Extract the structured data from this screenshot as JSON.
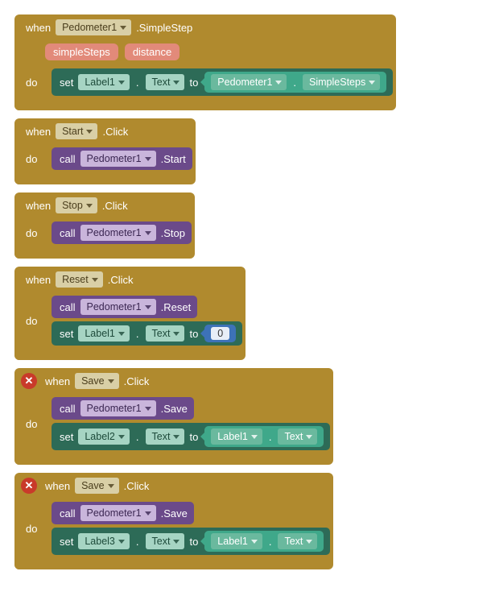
{
  "kw": {
    "when": "when",
    "do": "do",
    "call": "call",
    "set": "set",
    "to": "to"
  },
  "dot": ".",
  "blocks": [
    {
      "event_target": "Pedometer1",
      "event_name": "SimpleStep",
      "params": [
        "simpleSteps",
        "distance"
      ],
      "stmts": [
        {
          "type": "set",
          "target": "Label1",
          "prop": "Text",
          "value": {
            "type": "getprop",
            "target": "Pedometer1",
            "prop": "SimpleSteps"
          }
        }
      ]
    },
    {
      "event_target": "Start",
      "event_name": "Click",
      "stmts": [
        {
          "type": "call",
          "target": "Pedometer1",
          "method": "Start"
        }
      ]
    },
    {
      "event_target": "Stop",
      "event_name": "Click",
      "stmts": [
        {
          "type": "call",
          "target": "Pedometer1",
          "method": "Stop"
        }
      ]
    },
    {
      "event_target": "Reset",
      "event_name": "Click",
      "stmts": [
        {
          "type": "call",
          "target": "Pedometer1",
          "method": "Reset"
        },
        {
          "type": "set",
          "target": "Label1",
          "prop": "Text",
          "value": {
            "type": "number",
            "v": "0"
          }
        }
      ]
    },
    {
      "error": true,
      "event_target": "Save",
      "event_name": "Click",
      "stmts": [
        {
          "type": "call",
          "target": "Pedometer1",
          "method": "Save"
        },
        {
          "type": "set",
          "target": "Label2",
          "prop": "Text",
          "value": {
            "type": "getprop",
            "target": "Label1",
            "prop": "Text"
          }
        }
      ]
    },
    {
      "error": true,
      "event_target": "Save",
      "event_name": "Click",
      "stmts": [
        {
          "type": "call",
          "target": "Pedometer1",
          "method": "Save"
        },
        {
          "type": "set",
          "target": "Label3",
          "prop": "Text",
          "value": {
            "type": "getprop",
            "target": "Label1",
            "prop": "Text"
          }
        }
      ]
    }
  ]
}
